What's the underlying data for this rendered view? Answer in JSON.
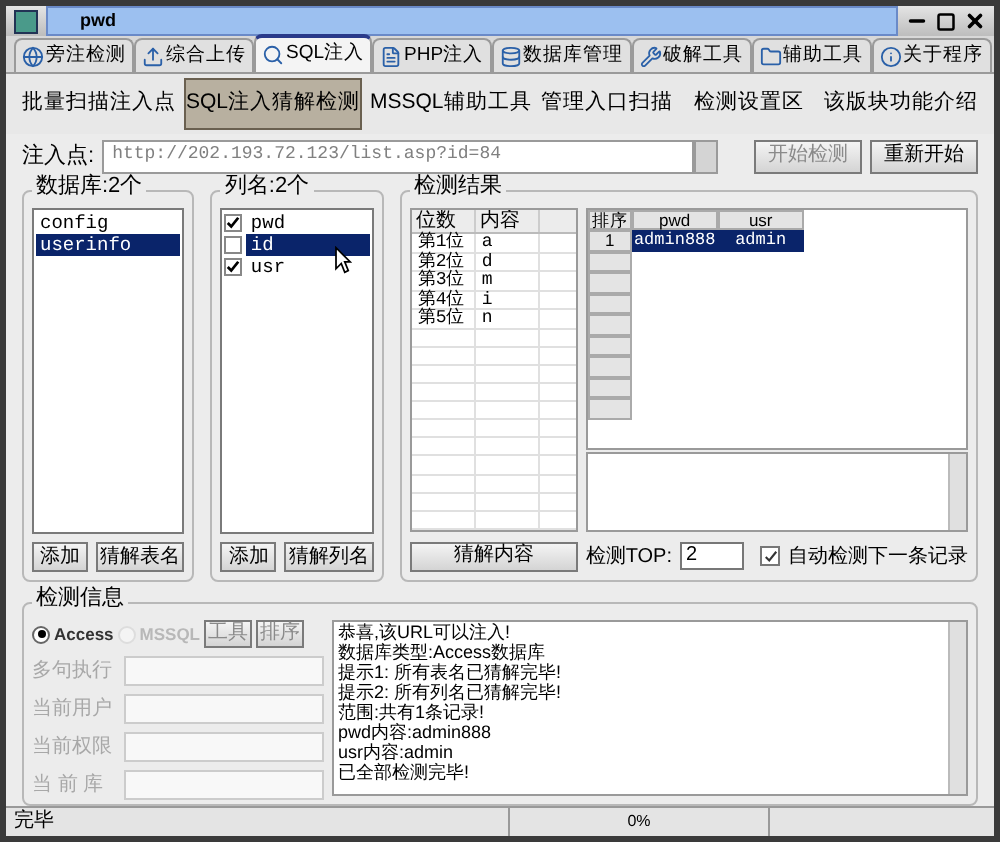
{
  "window": {
    "title": "pwd"
  },
  "tabs": [
    {
      "label": "旁注检测",
      "selected": false
    },
    {
      "label": "综合上传",
      "selected": false
    },
    {
      "label": "SQL注入",
      "selected": true
    },
    {
      "label": "PHP注入",
      "selected": false
    },
    {
      "label": "数据库管理",
      "selected": false
    },
    {
      "label": "破解工具",
      "selected": false
    },
    {
      "label": "辅助工具",
      "selected": false
    },
    {
      "label": "关于程序",
      "selected": false
    }
  ],
  "subtabs": [
    {
      "label": "批量扫描注入点",
      "selected": false
    },
    {
      "label": "SQL注入猜解检测",
      "selected": true
    },
    {
      "label": "MSSQL辅助工具",
      "selected": false
    },
    {
      "label": "管理入口扫描",
      "selected": false
    },
    {
      "label": "检测设置区",
      "selected": false
    },
    {
      "label": "该版块功能介绍",
      "selected": false
    }
  ],
  "injection": {
    "label": "注入点:",
    "value": "http://202.193.72.123/list.asp?id=84",
    "buttons": [
      {
        "label": "开始检测",
        "disabled": true
      },
      {
        "label": "重新开始",
        "disabled": false
      }
    ]
  },
  "databases": {
    "title": "数据库:2个",
    "items": [
      {
        "label": "config",
        "selected": false
      },
      {
        "label": "userinfo",
        "selected": true
      }
    ],
    "buttons": [
      "添加",
      "猜解表名"
    ]
  },
  "columns": {
    "title": "列名:2个",
    "items": [
      {
        "label": "pwd",
        "checked": true,
        "selected": false
      },
      {
        "label": "id",
        "checked": false,
        "selected": true
      },
      {
        "label": "usr",
        "checked": true,
        "selected": false
      }
    ],
    "buttons": [
      "添加",
      "猜解列名"
    ]
  },
  "results": {
    "title": "检测结果",
    "positions": {
      "columns": [
        "位数",
        "内容"
      ],
      "rows": [
        [
          "第1位",
          "a"
        ],
        [
          "第2位",
          "d"
        ],
        [
          "第3位",
          "m"
        ],
        [
          "第4位",
          "i"
        ],
        [
          "第5位",
          "n"
        ]
      ]
    },
    "records": {
      "columns": [
        "排序",
        "pwd",
        "usr"
      ],
      "rows": [
        {
          "cells": [
            "1",
            "admin888",
            "admin"
          ],
          "selected": true
        }
      ]
    },
    "decode_button": "猜解内容",
    "top_label": "检测TOP:",
    "top_value": "2",
    "auto_next": {
      "label": "自动检测下一条记录",
      "checked": true
    }
  },
  "info": {
    "title": "检测信息",
    "db_types": [
      {
        "label": "Access",
        "selected": true,
        "disabled": false
      },
      {
        "label": "MSSQL",
        "selected": false,
        "disabled": true
      }
    ],
    "buttons": [
      {
        "label": "工具",
        "disabled": true
      },
      {
        "label": "排序",
        "disabled": true
      }
    ],
    "fields": [
      {
        "label": "多句执行",
        "disabled": true
      },
      {
        "label": "当前用户",
        "disabled": true
      },
      {
        "label": "当前权限",
        "disabled": true
      },
      {
        "label": "当 前 库",
        "disabled": true
      }
    ],
    "log": [
      "恭喜,该URL可以注入!",
      "数据库类型:Access数据库",
      "提示1: 所有表名已猜解完毕!",
      "提示2: 所有列名已猜解完毕!",
      "范围:共有1条记录!",
      "pwd内容:admin888",
      "usr内容:admin",
      "已全部检测完毕!"
    ]
  },
  "status_bar": {
    "text": "完毕",
    "progress": "0%"
  }
}
